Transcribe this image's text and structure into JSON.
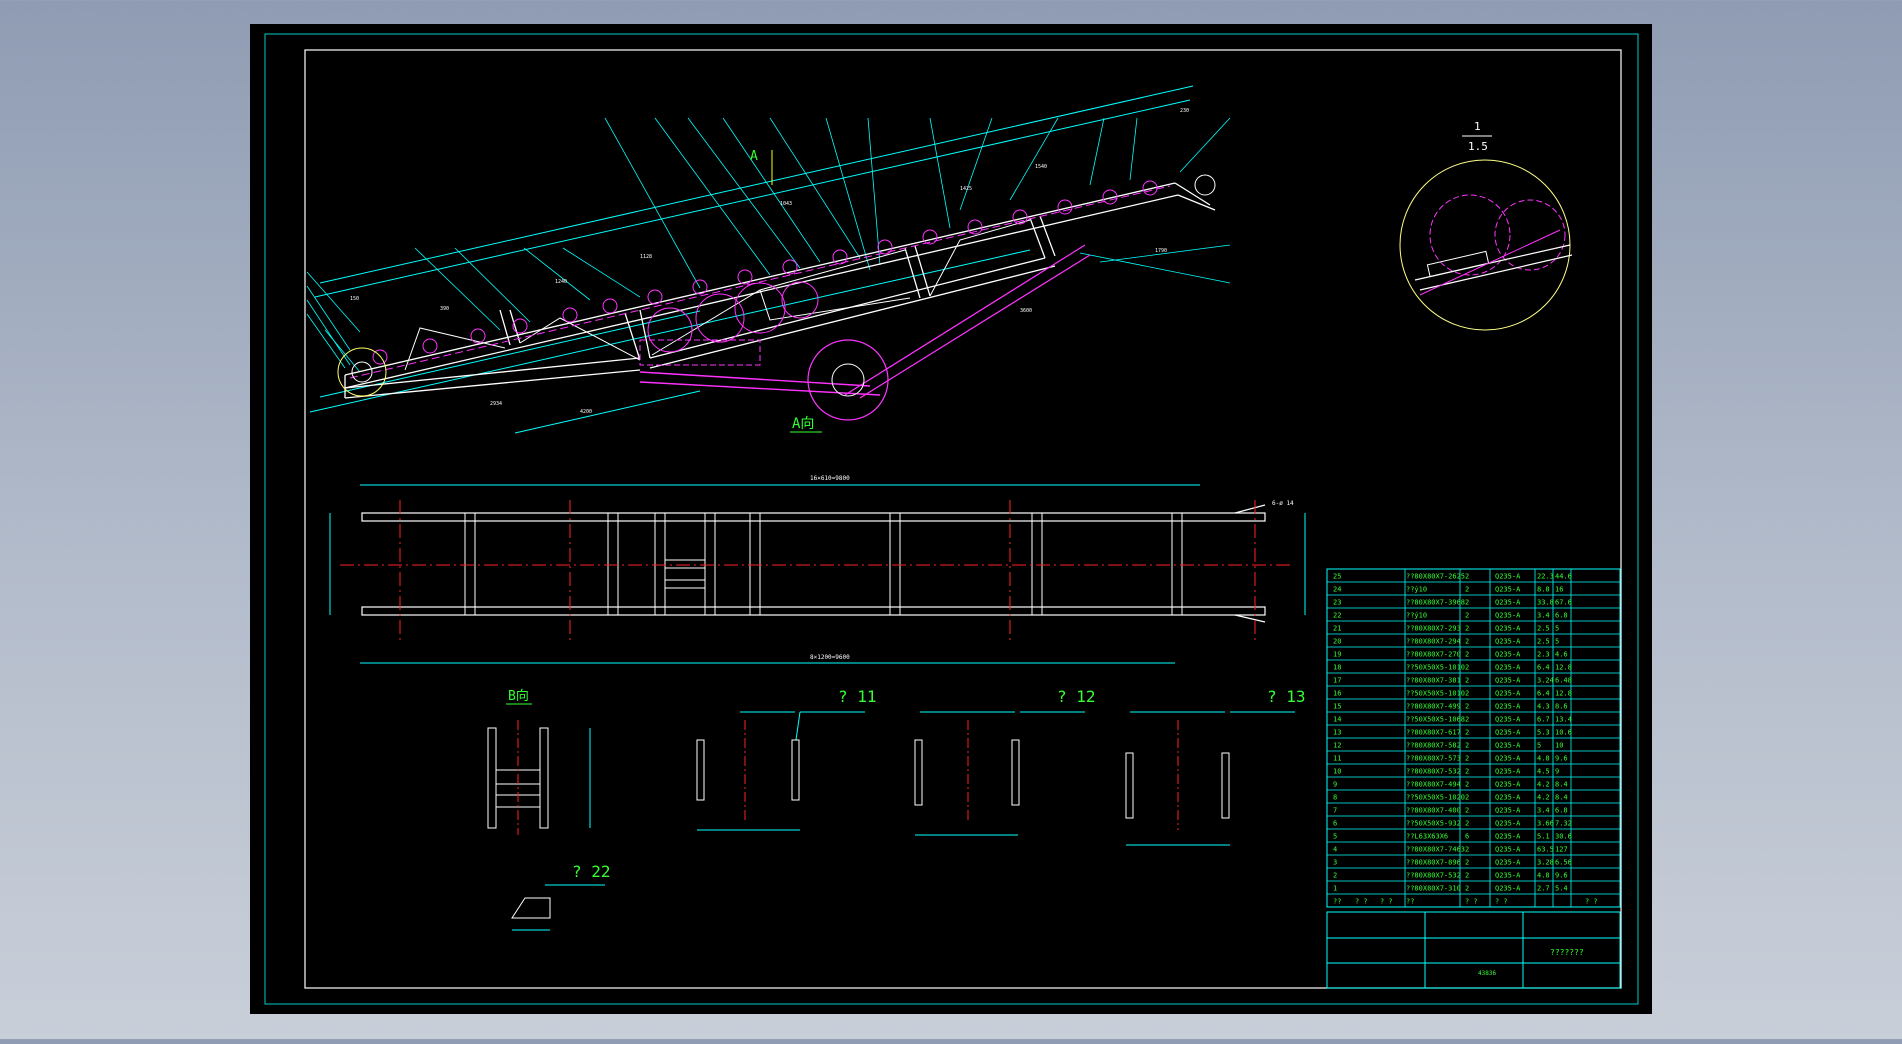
{
  "colors": {
    "background": "#8f9cb3",
    "sheet": "#000000",
    "frame": "#ffffff",
    "cyan": "#00ffff",
    "magenta": "#ff33ff",
    "green": "#33ff33",
    "red": "#ff2222",
    "yellow": "#ffff00"
  },
  "views": {
    "view_a_label": "A向",
    "view_b_label": "B向",
    "arrow_a": "A",
    "detail_scale_top": "1",
    "detail_scale_bottom": "1.5",
    "callout_11": "? 11",
    "callout_12": "? 12",
    "callout_13": "? 13",
    "callout_22": "? 22",
    "plan_top_dim": "16×610=9800",
    "plan_bottom_dim": "8×1200=9600",
    "hole_note": "6-ø 14"
  },
  "bom": {
    "rows": [
      {
        "no": "25",
        "spec": "??80X80X7-2625",
        "qty": "2",
        "mat": "Q235-A",
        "w1": "22.3",
        "w2": "44.6"
      },
      {
        "no": "24",
        "spec": "??ý10",
        "qty": "2",
        "mat": "Q235-A",
        "w1": "8.8",
        "w2": "16"
      },
      {
        "no": "23",
        "spec": "??80X80X7-3968",
        "qty": "2",
        "mat": "Q235-A",
        "w1": "33.8",
        "w2": "67.6"
      },
      {
        "no": "22",
        "spec": "??ý10",
        "qty": "2",
        "mat": "Q235-A",
        "w1": "3.4",
        "w2": "6.8"
      },
      {
        "no": "21",
        "spec": "??80X80X7-293",
        "qty": "2",
        "mat": "Q235-A",
        "w1": "2.5",
        "w2": "5"
      },
      {
        "no": "20",
        "spec": "??80X80X7-294",
        "qty": "2",
        "mat": "Q235-A",
        "w1": "2.5",
        "w2": "5"
      },
      {
        "no": "19",
        "spec": "??80X80X7-270",
        "qty": "2",
        "mat": "Q235-A",
        "w1": "2.3",
        "w2": "4.6"
      },
      {
        "no": "18",
        "spec": "??50X50X5-1010",
        "qty": "2",
        "mat": "Q235-A",
        "w1": "6.4",
        "w2": "12.8"
      },
      {
        "no": "17",
        "spec": "??80X80X7-381",
        "qty": "2",
        "mat": "Q235-A",
        "w1": "3.24",
        "w2": "6.48"
      },
      {
        "no": "16",
        "spec": "??50X50X5-1010",
        "qty": "2",
        "mat": "Q235-A",
        "w1": "6.4",
        "w2": "12.8"
      },
      {
        "no": "15",
        "spec": "??80X80X7-499",
        "qty": "2",
        "mat": "Q235-A",
        "w1": "4.3",
        "w2": "8.6"
      },
      {
        "no": "14",
        "spec": "??50X50X5-1068",
        "qty": "2",
        "mat": "Q235-A",
        "w1": "6.7",
        "w2": "13.4"
      },
      {
        "no": "13",
        "spec": "??80X80X7-617",
        "qty": "2",
        "mat": "Q235-A",
        "w1": "5.3",
        "w2": "10.6"
      },
      {
        "no": "12",
        "spec": "??80X80X7-582",
        "qty": "2",
        "mat": "Q235-A",
        "w1": "5",
        "w2": "10"
      },
      {
        "no": "11",
        "spec": "??80X80X7-573",
        "qty": "2",
        "mat": "Q235-A",
        "w1": "4.8",
        "w2": "9.6"
      },
      {
        "no": "10",
        "spec": "??80X80X7-532",
        "qty": "2",
        "mat": "Q235-A",
        "w1": "4.5",
        "w2": "9"
      },
      {
        "no": "9",
        "spec": "??80X80X7-494",
        "qty": "2",
        "mat": "Q235-A",
        "w1": "4.2",
        "w2": "8.4"
      },
      {
        "no": "8",
        "spec": "??50X50X5-1020",
        "qty": "2",
        "mat": "Q235-A",
        "w1": "4.2",
        "w2": "8.4"
      },
      {
        "no": "7",
        "spec": "??80X80X7-400",
        "qty": "2",
        "mat": "Q235-A",
        "w1": "3.4",
        "w2": "6.8"
      },
      {
        "no": "6",
        "spec": "??50X50X5-932",
        "qty": "2",
        "mat": "Q235-A",
        "w1": "3.66",
        "w2": "7.32"
      },
      {
        "no": "5",
        "spec": "??L63X63X6",
        "qty": "6",
        "mat": "Q235-A",
        "w1": "5.1",
        "w2": "30.6"
      },
      {
        "no": "4",
        "spec": "??80X80X7-7463",
        "qty": "2",
        "mat": "Q235-A",
        "w1": "63.5",
        "w2": "127"
      },
      {
        "no": "3",
        "spec": "??80X80X7-896",
        "qty": "2",
        "mat": "Q235-A",
        "w1": "3.28",
        "w2": "6.56"
      },
      {
        "no": "2",
        "spec": "??80X80X7-532",
        "qty": "2",
        "mat": "Q235-A",
        "w1": "4.8",
        "w2": "9.6"
      },
      {
        "no": "1",
        "spec": "??80X80X7-310",
        "qty": "2",
        "mat": "Q235-A",
        "w1": "2.7",
        "w2": "5.4"
      }
    ],
    "header": [
      "??",
      "? ?",
      "? ?",
      "??",
      "? ?",
      "? ?",
      "? ?"
    ],
    "title_block_name": "???????",
    "title_block_id": "43836"
  }
}
